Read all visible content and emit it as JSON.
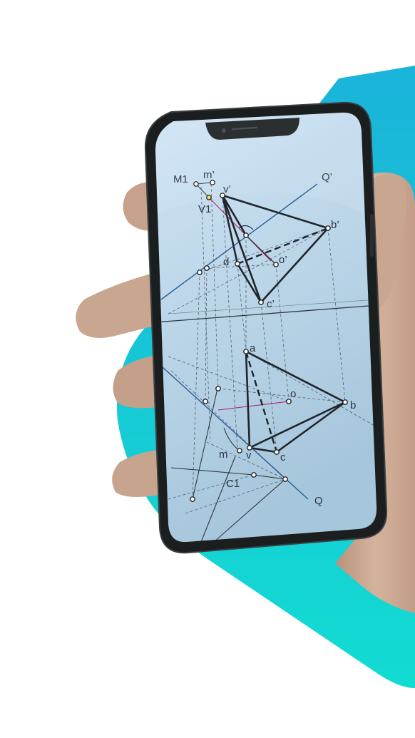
{
  "colors": {
    "background": "#ffffff",
    "accent_top": "#1bb3da",
    "accent_bottom": "#12dcd2",
    "phone_frame": "#1b1e1f",
    "screen_top": "#c7def0",
    "screen_bottom": "#a9c9dd",
    "skin": "#c8a58f",
    "drawing_line": "#2f3740",
    "blue_line": "#2b5d92",
    "magenta_line": "#b0246e"
  },
  "drawing": {
    "labels": {
      "M1": "M1",
      "m_prime": "m’",
      "v_prime": "v’",
      "V1": "V1",
      "Q_prime": "Q’",
      "b_prime": "b’",
      "d": "d",
      "o_prime": "o’",
      "c_prime": "c’",
      "a": "a",
      "o": "o",
      "b": "b",
      "m": "m",
      "v": "v",
      "c": "c",
      "C1": "C1",
      "Q": "Q"
    }
  }
}
